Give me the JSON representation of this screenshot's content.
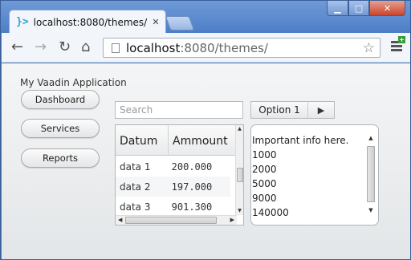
{
  "browser": {
    "tab_title": "localhost:8080/themes/",
    "tab_icon": "vaadin-logo-icon",
    "url_host": "localhost",
    "url_path": ":8080/themes/",
    "window_controls": {
      "minimize": "▁",
      "maximize": "□",
      "close": "✕"
    }
  },
  "app": {
    "title": "My Vaadin Application",
    "nav": [
      {
        "label": "Dashboard"
      },
      {
        "label": "Services"
      },
      {
        "label": "Reports"
      }
    ],
    "search": {
      "placeholder": "Search"
    },
    "select": {
      "value": "Option 1"
    },
    "table": {
      "columns": [
        "Datum",
        "Ammount"
      ],
      "rows": [
        [
          "data 1",
          "200.000"
        ],
        [
          "data 2",
          "197.000"
        ],
        [
          "data 3",
          "901.300"
        ]
      ]
    },
    "panel": {
      "lines": [
        "Important info here.",
        "1000",
        "2000",
        "5000",
        "9000",
        "140000"
      ]
    }
  }
}
